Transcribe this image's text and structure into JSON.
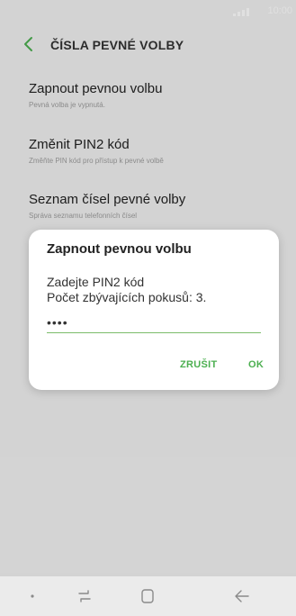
{
  "statusbar": {
    "time": "10:00"
  },
  "header": {
    "title": "ČÍSLA PEVNÉ VOLBY"
  },
  "settings": {
    "items": [
      {
        "title": "Zapnout pevnou volbu",
        "subtitle": "Pevná volba je vypnutá."
      },
      {
        "title": "Změnit PIN2 kód",
        "subtitle": "Změňte PIN kód pro přístup k pevné volbě"
      },
      {
        "title": "Seznam čísel pevné volby",
        "subtitle": "Správa seznamu telefonních čísel"
      }
    ]
  },
  "dialog": {
    "title": "Zapnout pevnou volbu",
    "prompt": "Zadejte PIN2 kód",
    "attempts": "Počet zbývajících pokusů: 3.",
    "pin_value": "••••",
    "cancel_label": "ZRUŠIT",
    "ok_label": "OK"
  },
  "navbar": {
    "buttons": [
      "recent-apps",
      "home",
      "back"
    ]
  },
  "colors": {
    "accent": "#4caf50",
    "input_underline": "#7bbd6a",
    "background": "#f1f1f1",
    "dialog": "#ffffff"
  }
}
